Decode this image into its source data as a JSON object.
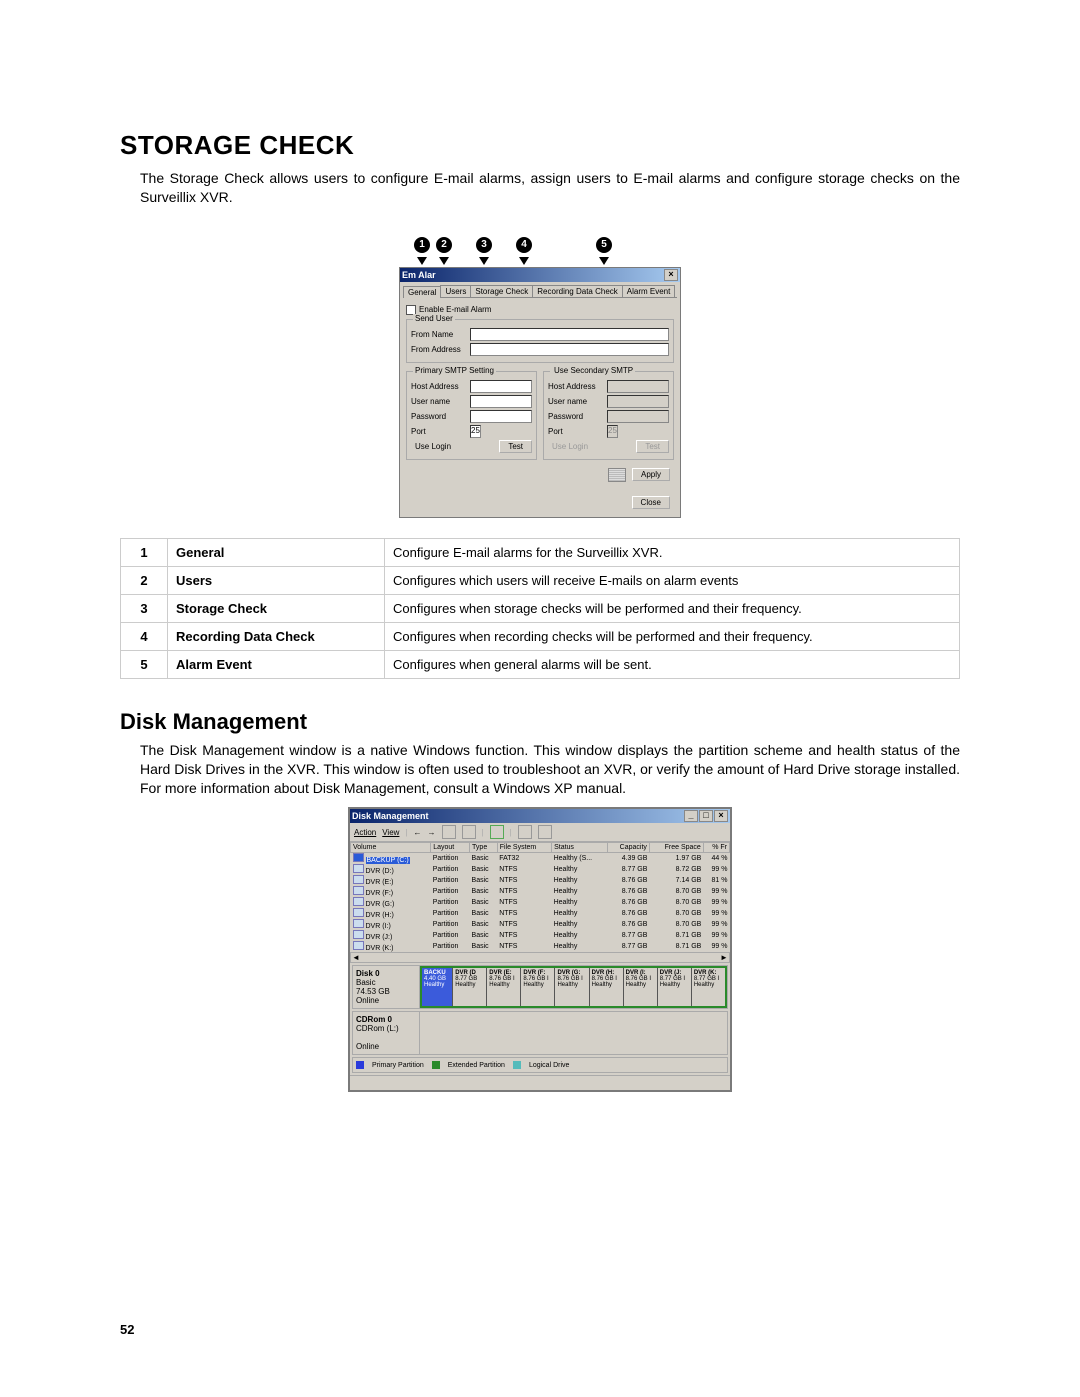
{
  "pageNumber": "52",
  "section1": {
    "title": "STORAGE CHECK",
    "para": "The Storage Check allows users to configure E-mail alarms, assign users to E-mail alarms and configure storage checks on the Surveillix XVR."
  },
  "callouts": [
    "1",
    "2",
    "3",
    "4",
    "5"
  ],
  "dialog": {
    "title": "Em    Alar",
    "close": "×",
    "tabs": [
      "General",
      "Users",
      "Storage Check",
      "Recording Data Check",
      "Alarm Event"
    ],
    "enable": "Enable E-mail Alarm",
    "sendUser": "Send User",
    "fromName": "From Name",
    "fromAddress": "From Address",
    "primary": "Primary SMTP Setting",
    "secondaryChk": "Use Secondary SMTP",
    "hostAddress": "Host Address",
    "username": "User name",
    "password": "Password",
    "port": "Port",
    "portVal": "25",
    "useLogin": "Use Login",
    "test": "Test",
    "apply": "Apply",
    "closeBtn": "Close"
  },
  "featTable": [
    {
      "n": "1",
      "t": "General",
      "d": "Configure E-mail alarms for the Surveillix XVR."
    },
    {
      "n": "2",
      "t": "Users",
      "d": "Configures which users will receive E-mails on alarm events"
    },
    {
      "n": "3",
      "t": "Storage Check",
      "d": "Configures when storage checks will be performed and their frequency."
    },
    {
      "n": "4",
      "t": "Recording Data Check",
      "d": "Configures when recording checks will be performed and their frequency."
    },
    {
      "n": "5",
      "t": "Alarm Event",
      "d": "Configures when general alarms will be sent."
    }
  ],
  "section2": {
    "title": "Disk Management",
    "para": "The Disk Management window is a native Windows function. This window displays the partition scheme and health status of the Hard Disk Drives in the XVR. This window is often used to troubleshoot an XVR, or verify the amount of Hard Drive storage installed. For more information about Disk Management, consult a Windows XP manual."
  },
  "dm": {
    "title": "Disk Management",
    "menu": {
      "action": "Action",
      "view": "View"
    },
    "cols": [
      "Volume",
      "Layout",
      "Type",
      "File System",
      "Status",
      "Capacity",
      "Free Space",
      "% Fr"
    ],
    "rows": [
      {
        "v": "BACKUP (C:)",
        "sel": true,
        "l": "Partition",
        "t": "Basic",
        "fs": "FAT32",
        "s": "Healthy (S...",
        "c": "4.39 GB",
        "f": "1.97 GB",
        "p": "44 %"
      },
      {
        "v": "DVR (D:)",
        "l": "Partition",
        "t": "Basic",
        "fs": "NTFS",
        "s": "Healthy",
        "c": "8.77 GB",
        "f": "8.72 GB",
        "p": "99 %"
      },
      {
        "v": "DVR (E:)",
        "l": "Partition",
        "t": "Basic",
        "fs": "NTFS",
        "s": "Healthy",
        "c": "8.76 GB",
        "f": "7.14 GB",
        "p": "81 %"
      },
      {
        "v": "DVR (F:)",
        "l": "Partition",
        "t": "Basic",
        "fs": "NTFS",
        "s": "Healthy",
        "c": "8.76 GB",
        "f": "8.70 GB",
        "p": "99 %"
      },
      {
        "v": "DVR (G:)",
        "l": "Partition",
        "t": "Basic",
        "fs": "NTFS",
        "s": "Healthy",
        "c": "8.76 GB",
        "f": "8.70 GB",
        "p": "99 %"
      },
      {
        "v": "DVR (H:)",
        "l": "Partition",
        "t": "Basic",
        "fs": "NTFS",
        "s": "Healthy",
        "c": "8.76 GB",
        "f": "8.70 GB",
        "p": "99 %"
      },
      {
        "v": "DVR (I:)",
        "l": "Partition",
        "t": "Basic",
        "fs": "NTFS",
        "s": "Healthy",
        "c": "8.76 GB",
        "f": "8.70 GB",
        "p": "99 %"
      },
      {
        "v": "DVR (J:)",
        "l": "Partition",
        "t": "Basic",
        "fs": "NTFS",
        "s": "Healthy",
        "c": "8.77 GB",
        "f": "8.71 GB",
        "p": "99 %"
      },
      {
        "v": "DVR (K:)",
        "l": "Partition",
        "t": "Basic",
        "fs": "NTFS",
        "s": "Healthy",
        "c": "8.77 GB",
        "f": "8.71 GB",
        "p": "99 %"
      }
    ],
    "disk0": {
      "name": "Disk 0",
      "type": "Basic",
      "size": "74.53 GB",
      "status": "Online"
    },
    "parts": [
      {
        "n": "BACKU",
        "s": "4.40 GB",
        "st": "Healthy",
        "first": true
      },
      {
        "n": "DVR (D",
        "s": "8.77 GB",
        "st": "Healthy"
      },
      {
        "n": "DVR (E:",
        "s": "8.76 GB I",
        "st": "Healthy"
      },
      {
        "n": "DVR (F:",
        "s": "8.76 GB I",
        "st": "Healthy"
      },
      {
        "n": "DVR (G:",
        "s": "8.76 GB I",
        "st": "Healthy"
      },
      {
        "n": "DVR (H:",
        "s": "8.76 GB I",
        "st": "Healthy"
      },
      {
        "n": "DVR (I:",
        "s": "8.76 GB I",
        "st": "Healthy"
      },
      {
        "n": "DVR (J:",
        "s": "8.77 GB I",
        "st": "Healthy"
      },
      {
        "n": "DVR (K:",
        "s": "8.77 GB I",
        "st": "Healthy"
      }
    ],
    "cdrom": {
      "name": "CDRom 0",
      "sub": "CDRom (L:)",
      "status": "Online"
    },
    "legend": {
      "pp": "Primary Partition",
      "ep": "Extended Partition",
      "ld": "Logical Drive"
    }
  }
}
